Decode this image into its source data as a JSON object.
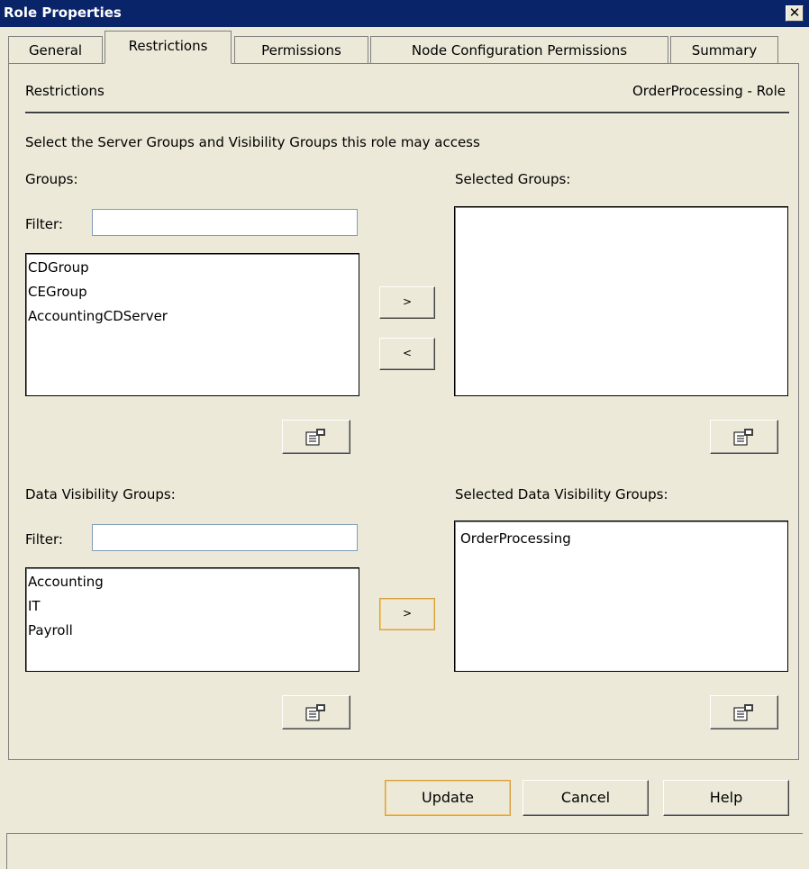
{
  "window": {
    "title": "Role Properties"
  },
  "tabs": [
    "General",
    "Restrictions",
    "Permissions",
    "Node Configuration Permissions",
    "Summary"
  ],
  "active_tab": "Restrictions",
  "header": {
    "section": "Restrictions",
    "role": "OrderProcessing - Role"
  },
  "instructions": "Select the Server Groups and Visibility Groups this role may access",
  "server_groups": {
    "label": "Groups:",
    "filter_label": "Filter:",
    "filter_value": "",
    "items": [
      "CDGroup",
      "CEGroup",
      "AccountingCDServer"
    ],
    "selected_label": "Selected Groups:",
    "selected_items": []
  },
  "visibility_groups": {
    "label": "Data Visibility Groups:",
    "filter_label": "Filter:",
    "filter_value": "",
    "items": [
      "Accounting",
      "IT",
      "Payroll"
    ],
    "selected_label": "Selected Data Visibility Groups:",
    "selected_items": [
      "OrderProcessing"
    ]
  },
  "buttons": {
    "add": ">",
    "remove": "<",
    "update": "Update",
    "cancel": "Cancel",
    "help": "Help",
    "close": "✕"
  },
  "icons": {
    "properties": "properties-icon"
  }
}
